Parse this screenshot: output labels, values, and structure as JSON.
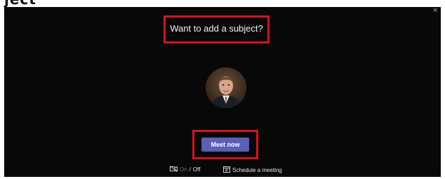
{
  "page_header": {
    "cropped_title": "ject"
  },
  "dialog": {
    "close_glyph": "×",
    "subject_prompt": "Want to add a subject?",
    "meet_label": "Meet now",
    "video_toggle": {
      "on_label": "On",
      "separator": "/",
      "off_label": "Off",
      "state": "Off"
    },
    "schedule_label": "Schedule a meeting",
    "icons": [
      "video-off-icon",
      "calendar-icon",
      "avatar-photo"
    ],
    "colors": {
      "accent": "#5b5fb6",
      "highlight": "#d4141e",
      "background": "#080808"
    }
  }
}
